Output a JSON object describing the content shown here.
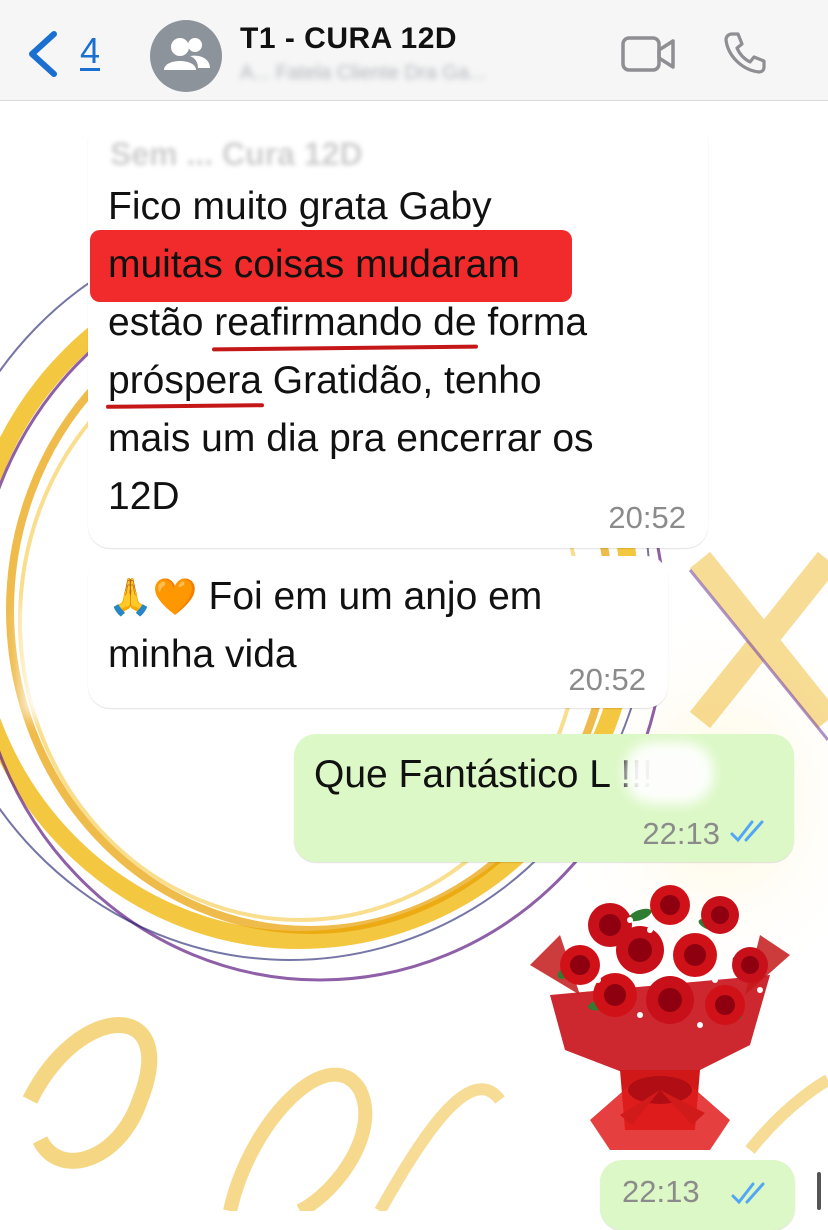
{
  "header": {
    "back_count": "4",
    "title": "T1 - CURA 12D",
    "subtitle": "A... Fatela  Cliente  Dra Ga..."
  },
  "messages": [
    {
      "direction": "incoming",
      "faded_header": "Sem ... Cura 12D",
      "line1": "Fico muito grata Gaby",
      "highlight": "muitas coisas mudaram",
      "line3_pre": "estão ",
      "underline1": "reafirmando de",
      "line3_post": " forma",
      "underline2": "próspera",
      "line4_post": " Gratidão, tenho",
      "line5": "mais um dia pra encerrar os",
      "line6": "12D",
      "time": "20:52"
    },
    {
      "direction": "incoming",
      "emojis": "🙏🧡",
      "line1": " Foi em um anjo em",
      "line2": "minha vida",
      "time": "20:52"
    },
    {
      "direction": "outgoing",
      "text": "Que Fantástico L       !!!",
      "time": "22:13",
      "status": "read"
    },
    {
      "direction": "outgoing",
      "type": "image",
      "image_subject": "red-rose-bouquet",
      "time": "22:13",
      "status": "read"
    }
  ],
  "colors": {
    "accent": "#1a6fd1",
    "incoming_bubble": "#ffffff",
    "outgoing_bubble": "#dcf8c6",
    "highlight": "#f02020",
    "read_ticks": "#53a6f5"
  }
}
